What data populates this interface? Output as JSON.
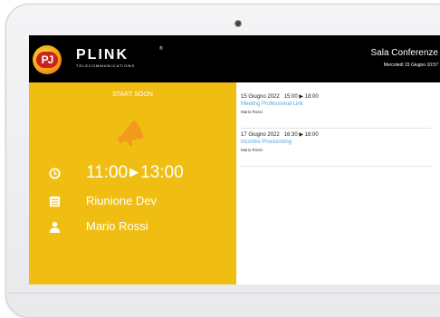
{
  "header": {
    "brand": "PLINK",
    "brand_mark": "®",
    "tagline": "TELECOMMUNICATIONS",
    "logo_monogram": "PJ",
    "room_name": "Sala Conferenze",
    "current_datetime": "Mercoledì 15 Giugno 10:57"
  },
  "status": {
    "label": "START SOON",
    "icon": "megaphone-icon",
    "time_start": "11:00",
    "time_arrow": "▶",
    "time_end": "13:00",
    "meeting_title": "Riunione Dev",
    "organizer": "Mario Rossi"
  },
  "schedule": [
    {
      "date": "15 Giugno 2022",
      "time": "15:00 ▶ 18:00",
      "title": "Meeting Professional Link",
      "organizer": "Mario Rossi"
    },
    {
      "date": "17 Giugno 2022",
      "time": "16:30 ▶ 18:00",
      "title": "Incontro Provisioning",
      "organizer": "Mario Rossi"
    }
  ],
  "colors": {
    "panel_yellow": "#f0be12",
    "header_black": "#000000",
    "link_blue": "#4fa7d8",
    "megaphone_orange": "#f29a1c"
  }
}
